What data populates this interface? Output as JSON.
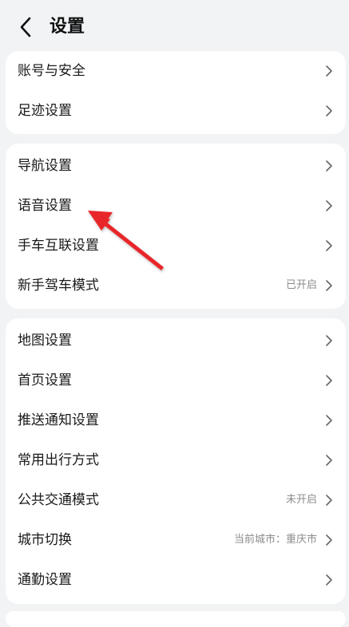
{
  "header": {
    "title": "设置",
    "back_icon": "chevron-left-icon"
  },
  "groups": [
    {
      "items": [
        {
          "label": "账号与安全",
          "value": ""
        },
        {
          "label": "足迹设置",
          "value": ""
        }
      ]
    },
    {
      "items": [
        {
          "label": "导航设置",
          "value": ""
        },
        {
          "label": "语音设置",
          "value": ""
        },
        {
          "label": "手车互联设置",
          "value": ""
        },
        {
          "label": "新手驾车模式",
          "value": "已开启"
        }
      ]
    },
    {
      "items": [
        {
          "label": "地图设置",
          "value": ""
        },
        {
          "label": "首页设置",
          "value": ""
        },
        {
          "label": "推送通知设置",
          "value": ""
        },
        {
          "label": "常用出行方式",
          "value": ""
        },
        {
          "label": "公共交通模式",
          "value": "未开启"
        },
        {
          "label": "城市切换",
          "value": "当前城市：重庆市"
        },
        {
          "label": "通勤设置",
          "value": ""
        }
      ]
    }
  ],
  "colors": {
    "background": "#f1f3f5",
    "card": "#ffffff",
    "annotation_arrow": "#e8252a"
  },
  "annotation": {
    "icon": "red-pointer-arrow-icon"
  }
}
